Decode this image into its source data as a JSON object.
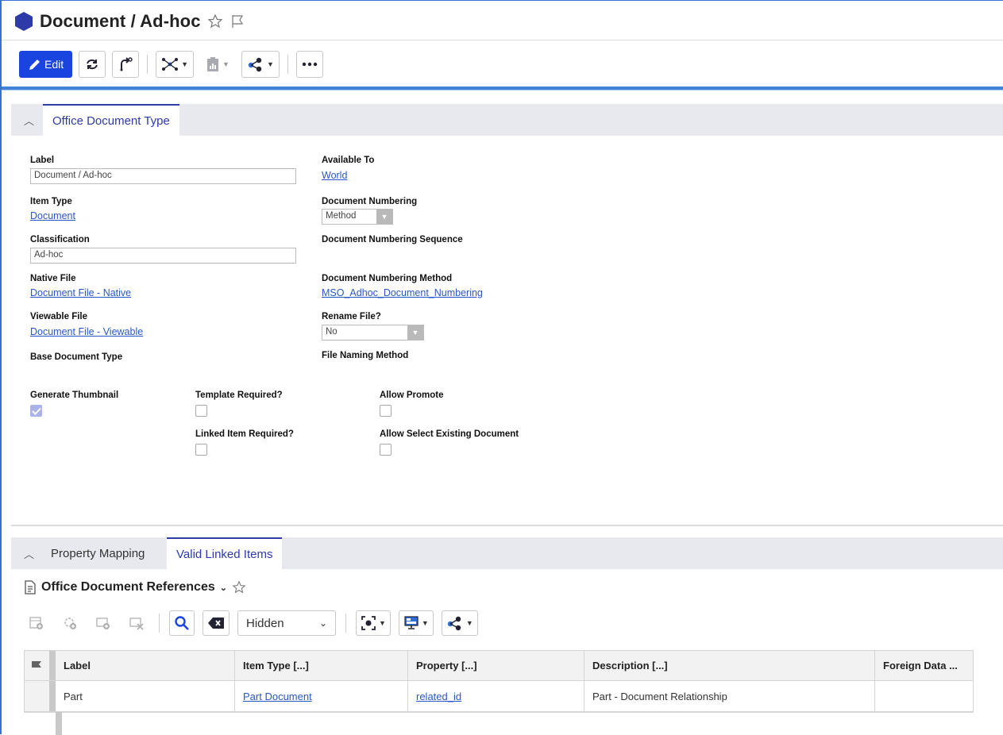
{
  "window": {
    "title": "Document / Ad-hoc"
  },
  "toolbar": {
    "edit_label": "Edit"
  },
  "form_section": {
    "tab_label": "Office Document Type",
    "fields": {
      "label": {
        "label": "Label",
        "value": "Document / Ad-hoc"
      },
      "item_type": {
        "label": "Item Type",
        "value": "Document"
      },
      "classification": {
        "label": "Classification",
        "value": "Ad-hoc"
      },
      "native_file": {
        "label": "Native File",
        "value": "Document File - Native"
      },
      "viewable_file": {
        "label": "Viewable File",
        "value": "Document File - Viewable"
      },
      "base_document_type": {
        "label": "Base Document Type"
      },
      "available_to": {
        "label": "Available To",
        "value": "World"
      },
      "document_numbering": {
        "label": "Document Numbering",
        "value": "Method"
      },
      "document_numbering_sequence": {
        "label": "Document Numbering Sequence"
      },
      "document_numbering_method": {
        "label": "Document Numbering Method",
        "value": "MSO_Adhoc_Document_Numbering"
      },
      "rename_file": {
        "label": "Rename File?",
        "value": "No"
      },
      "file_naming_method": {
        "label": "File Naming Method"
      }
    },
    "checkboxes": {
      "generate_thumbnail": {
        "label": "Generate Thumbnail",
        "checked": true
      },
      "template_required": {
        "label": "Template Required?",
        "checked": false
      },
      "linked_item_required": {
        "label": "Linked Item Required?",
        "checked": false
      },
      "allow_promote": {
        "label": "Allow Promote",
        "checked": false
      },
      "allow_select_existing": {
        "label": "Allow Select Existing Document",
        "checked": false
      }
    }
  },
  "relationships": {
    "tabs": [
      {
        "label": "Property Mapping",
        "active": false
      },
      {
        "label": "Valid Linked Items",
        "active": true
      }
    ],
    "grid_title": "Office Document References",
    "filter_dropdown": "Hidden",
    "columns": [
      "Label",
      "Item Type [...]",
      "Property [...]",
      "Description [...]",
      "Foreign Data ..."
    ],
    "rows": [
      {
        "label": "Part",
        "item_type": "Part Document",
        "property": "related_id",
        "description": "Part - Document Relationship",
        "foreign_data": ""
      }
    ]
  },
  "colors": {
    "accent": "#1a44e0",
    "tab_active": "#2d3aa8",
    "link": "#2a57c7",
    "title_icon": "#2d3aa8"
  }
}
